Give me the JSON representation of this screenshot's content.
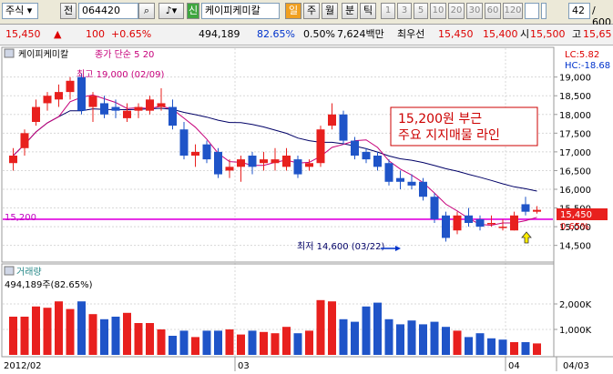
{
  "toolbar": {
    "market_label": "주식",
    "jeon_label": "전",
    "code": "064420",
    "search_icon": "magnifier-icon",
    "sound_icon": "speaker-icon",
    "new_badge": "신",
    "company": "케이피케미칼",
    "period_day": "일",
    "period_week": "주",
    "period_month": "월",
    "period_minute": "분",
    "period_tick": "틱",
    "intervals": [
      "1",
      "3",
      "5",
      "10",
      "20",
      "30",
      "60",
      "120"
    ],
    "count": "42",
    "total": "/ 600"
  },
  "quote": {
    "price": "15,450",
    "change_arrow": "▲",
    "change": "100",
    "change_pct": "+0.65%",
    "volume": "494,189",
    "volume_ratio": "82.65%",
    "turnover": "0.50%",
    "amount": "7,624백만",
    "best_label": "최우선",
    "ask": "15,450",
    "bid": "15,400",
    "open_label": "시",
    "open": "15,500",
    "high_label": "고",
    "high": "15,65"
  },
  "chart_data": {
    "type": "candlestick",
    "title": "케이피케미칼",
    "indicator_label": "종가 단순 5  20",
    "up_color": "#e8201e",
    "down_color": "#1f54c8",
    "ma5_color": "#c6007a",
    "ma20_color": "#000066",
    "support_color": "#e000e0",
    "ylim": [
      14200,
      19600
    ],
    "y_ticks": [
      14500,
      15000,
      15500,
      16000,
      16500,
      17000,
      17500,
      18000,
      18500,
      19000
    ],
    "y_tick_labels": [
      "14,500",
      "15,000",
      "15,500",
      "16,000",
      "16,500",
      "17,000",
      "17,500",
      "18,000",
      "18,500",
      "19,000"
    ],
    "lc_label": "LC:5.82",
    "hc_label": "HC:-18.68",
    "support_value": 15200,
    "support_label": "15,200",
    "last_price_label": "15,450",
    "last_pct_label": "0.65%",
    "annotation_text": [
      "15,200원 부근",
      "주요 지지매물 라인"
    ],
    "annotation_color": "#cc0000",
    "max_label": "최고 19,000 (02/09)",
    "min_label": "최저 14,600 (03/22)",
    "x_labels": [
      "2012/02",
      "03",
      "04",
      "04/03"
    ],
    "candles": [
      {
        "o": 16700,
        "h": 17100,
        "l": 16500,
        "c": 16900
      },
      {
        "o": 17100,
        "h": 17600,
        "l": 16900,
        "c": 17500
      },
      {
        "o": 17800,
        "h": 18400,
        "l": 17700,
        "c": 18200
      },
      {
        "o": 18300,
        "h": 18600,
        "l": 18100,
        "c": 18500
      },
      {
        "o": 18400,
        "h": 18800,
        "l": 18200,
        "c": 18600
      },
      {
        "o": 18600,
        "h": 19000,
        "l": 18400,
        "c": 18900
      },
      {
        "o": 19000,
        "h": 19100,
        "l": 18000,
        "c": 18100
      },
      {
        "o": 18200,
        "h": 18600,
        "l": 17800,
        "c": 18500
      },
      {
        "o": 18300,
        "h": 18500,
        "l": 17900,
        "c": 18000
      },
      {
        "o": 18200,
        "h": 18400,
        "l": 17900,
        "c": 18100
      },
      {
        "o": 17900,
        "h": 18300,
        "l": 17800,
        "c": 18100
      },
      {
        "o": 18100,
        "h": 18300,
        "l": 17900,
        "c": 18200
      },
      {
        "o": 18100,
        "h": 18500,
        "l": 18000,
        "c": 18400
      },
      {
        "o": 18200,
        "h": 18700,
        "l": 18100,
        "c": 18300
      },
      {
        "o": 18200,
        "h": 18400,
        "l": 17600,
        "c": 17700
      },
      {
        "o": 17600,
        "h": 17800,
        "l": 16800,
        "c": 16900
      },
      {
        "o": 16900,
        "h": 17200,
        "l": 16600,
        "c": 17000
      },
      {
        "o": 17200,
        "h": 17300,
        "l": 16700,
        "c": 16800
      },
      {
        "o": 17000,
        "h": 17100,
        "l": 16300,
        "c": 16400
      },
      {
        "o": 16500,
        "h": 16800,
        "l": 16300,
        "c": 16600
      },
      {
        "o": 16600,
        "h": 16900,
        "l": 16200,
        "c": 16800
      },
      {
        "o": 16900,
        "h": 17000,
        "l": 16400,
        "c": 16600
      },
      {
        "o": 16700,
        "h": 17000,
        "l": 16500,
        "c": 16800
      },
      {
        "o": 16700,
        "h": 17100,
        "l": 16500,
        "c": 16800
      },
      {
        "o": 16600,
        "h": 17100,
        "l": 16500,
        "c": 16900
      },
      {
        "o": 16800,
        "h": 16900,
        "l": 16300,
        "c": 16400
      },
      {
        "o": 16600,
        "h": 16800,
        "l": 16500,
        "c": 16700
      },
      {
        "o": 16700,
        "h": 17700,
        "l": 16600,
        "c": 17600
      },
      {
        "o": 17700,
        "h": 18300,
        "l": 17600,
        "c": 18000
      },
      {
        "o": 18000,
        "h": 18100,
        "l": 17200,
        "c": 17300
      },
      {
        "o": 17300,
        "h": 17400,
        "l": 16800,
        "c": 16900
      },
      {
        "o": 17000,
        "h": 17100,
        "l": 16700,
        "c": 16800
      },
      {
        "o": 16900,
        "h": 17000,
        "l": 16500,
        "c": 16600
      },
      {
        "o": 16700,
        "h": 16800,
        "l": 16100,
        "c": 16200
      },
      {
        "o": 16300,
        "h": 16500,
        "l": 16000,
        "c": 16200
      },
      {
        "o": 16200,
        "h": 16400,
        "l": 16000,
        "c": 16100
      },
      {
        "o": 16200,
        "h": 16300,
        "l": 15700,
        "c": 15800
      },
      {
        "o": 15800,
        "h": 15900,
        "l": 15100,
        "c": 15200
      },
      {
        "o": 15300,
        "h": 15400,
        "l": 14600,
        "c": 14700
      },
      {
        "o": 14900,
        "h": 15400,
        "l": 14800,
        "c": 15300
      },
      {
        "o": 15300,
        "h": 15500,
        "l": 15000,
        "c": 15100
      },
      {
        "o": 15200,
        "h": 15300,
        "l": 14900,
        "c": 15000
      },
      {
        "o": 15100,
        "h": 15300,
        "l": 15000,
        "c": 15100
      },
      {
        "o": 15000,
        "h": 15200,
        "l": 14900,
        "c": 15000
      },
      {
        "o": 14900,
        "h": 15400,
        "l": 14900,
        "c": 15300
      },
      {
        "o": 15600,
        "h": 15800,
        "l": 15300,
        "c": 15400
      },
      {
        "o": 15400,
        "h": 15550,
        "l": 15350,
        "c": 15450
      }
    ],
    "volume_label": "거래량",
    "volume_readout": "494,189주(82.65%)",
    "volume_ticks": [
      1000000,
      2000000
    ],
    "volume_tick_labels": [
      "1,000K",
      "2,000K"
    ],
    "volume_max": 2500000,
    "volumes": [
      1500000,
      1500000,
      1900000,
      1850000,
      2100000,
      1800000,
      2100000,
      1600000,
      1400000,
      1500000,
      1650000,
      1250000,
      1250000,
      1000000,
      750000,
      950000,
      700000,
      950000,
      950000,
      1000000,
      800000,
      950000,
      900000,
      850000,
      1100000,
      850000,
      950000,
      2150000,
      2100000,
      1400000,
      1300000,
      1900000,
      2050000,
      1400000,
      1200000,
      1350000,
      1200000,
      1300000,
      1100000,
      950000,
      700000,
      850000,
      650000,
      600000,
      500000,
      500000,
      450000
    ],
    "volume_up": [
      true,
      true,
      true,
      true,
      true,
      true,
      false,
      true,
      false,
      false,
      true,
      true,
      true,
      true,
      false,
      false,
      true,
      false,
      false,
      true,
      true,
      false,
      true,
      true,
      true,
      false,
      true,
      true,
      true,
      false,
      false,
      false,
      false,
      false,
      false,
      false,
      false,
      false,
      false,
      true,
      false,
      false,
      false,
      false,
      true,
      false,
      true
    ]
  }
}
